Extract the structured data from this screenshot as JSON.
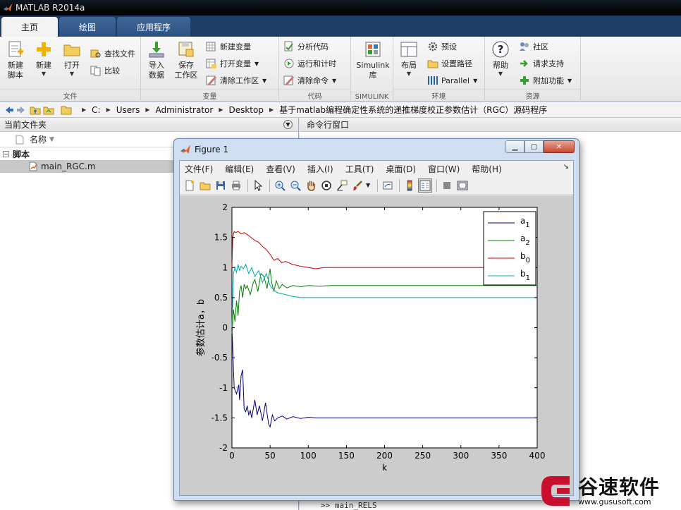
{
  "app": {
    "title": "MATLAB R2014a"
  },
  "tabs": [
    {
      "label": "主页",
      "active": true
    },
    {
      "label": "绘图",
      "active": false
    },
    {
      "label": "应用程序",
      "active": false
    }
  ],
  "ribbon": {
    "file": {
      "label": "文件",
      "new_script": "新建\n脚本",
      "new": "新建",
      "open": "打开",
      "find_files": "查找文件",
      "compare": "比较"
    },
    "variable": {
      "label": "变量",
      "import": "导入\n数据",
      "save_ws": "保存\n工作区",
      "new_var": "新建变量",
      "open_var": "打开变量",
      "clear_ws": "清除工作区"
    },
    "code": {
      "label": "代码",
      "analyze": "分析代码",
      "run_time": "运行和计时",
      "clear_cmd": "清除命令"
    },
    "simulink": {
      "label": "SIMULINK",
      "library": "Simulink\n库"
    },
    "env": {
      "label": "环境",
      "layout": "布局",
      "prefs": "预设",
      "set_path": "设置路径",
      "parallel": "Parallel"
    },
    "resources": {
      "label": "资源",
      "help": "帮助",
      "community": "社区",
      "support": "请求支持",
      "addons": "附加功能"
    }
  },
  "address": {
    "crumbs": [
      "C:",
      "Users",
      "Administrator",
      "Desktop",
      "基于matlab编程确定性系统的递推梯度校正参数估计（RGC）源码程序"
    ]
  },
  "left_panel": {
    "title": "当前文件夹",
    "col_name": "名称",
    "group": "脚本",
    "file": "main_RGC.m"
  },
  "command_window": {
    "title": "命令行窗口",
    "last_line": ">> main_RELS"
  },
  "figure": {
    "title": "Figure 1",
    "menus": [
      "文件(F)",
      "编辑(E)",
      "查看(V)",
      "插入(I)",
      "工具(T)",
      "桌面(D)",
      "窗口(W)",
      "帮助(H)"
    ]
  },
  "chart_data": {
    "type": "line",
    "xlabel": "k",
    "ylabel": "参数估计a，b",
    "xlim": [
      0,
      400
    ],
    "ylim": [
      -2,
      2
    ],
    "xticks": [
      0,
      50,
      100,
      150,
      200,
      250,
      300,
      350,
      400
    ],
    "yticks": [
      -2,
      -1.5,
      -1,
      -0.5,
      0,
      0.5,
      1,
      1.5,
      2
    ],
    "legend_position": "top-right",
    "series": [
      {
        "name": "a",
        "sub": "1",
        "color": "#000080",
        "x": [
          0,
          3,
          6,
          9,
          10,
          12,
          14,
          16,
          18,
          20,
          22,
          24,
          26,
          28,
          30,
          33,
          36,
          40,
          44,
          48,
          50,
          53,
          56,
          60,
          66,
          72,
          80,
          90,
          100,
          110,
          125,
          150,
          200,
          300,
          400
        ],
        "y": [
          0,
          -1.0,
          -1.1,
          -0.95,
          -1.2,
          -0.8,
          -0.7,
          -1.35,
          -1.4,
          -1.3,
          -1.45,
          -1.38,
          -1.5,
          -1.35,
          -1.2,
          -1.45,
          -1.3,
          -1.55,
          -1.25,
          -1.6,
          -1.65,
          -1.45,
          -1.55,
          -1.5,
          -1.47,
          -1.52,
          -1.48,
          -1.51,
          -1.49,
          -1.5,
          -1.5,
          -1.5,
          -1.5,
          -1.5,
          -1.5
        ]
      },
      {
        "name": "a",
        "sub": "2",
        "color": "#008000",
        "x": [
          0,
          2,
          4,
          6,
          8,
          10,
          12,
          14,
          16,
          18,
          20,
          24,
          28,
          30,
          34,
          38,
          42,
          46,
          50,
          52,
          55,
          58,
          62,
          66,
          72,
          80,
          90,
          100,
          115,
          130,
          160,
          200,
          300,
          400
        ],
        "y": [
          -0.1,
          0.3,
          0.1,
          0.45,
          0.2,
          0.6,
          0.7,
          0.5,
          0.72,
          0.65,
          0.7,
          0.55,
          0.75,
          0.8,
          0.6,
          0.9,
          0.85,
          0.65,
          0.98,
          0.75,
          0.6,
          0.78,
          0.65,
          0.72,
          0.66,
          0.7,
          0.68,
          0.7,
          0.69,
          0.7,
          0.7,
          0.7,
          0.7,
          0.7
        ]
      },
      {
        "name": "b",
        "sub": "0",
        "color": "#cc0000",
        "x": [
          0,
          1,
          3,
          5,
          8,
          12,
          16,
          20,
          25,
          30,
          35,
          40,
          45,
          50,
          55,
          60,
          65,
          70,
          80,
          90,
          100,
          110,
          120,
          140,
          160,
          200,
          300,
          400
        ],
        "y": [
          1.0,
          1.5,
          1.6,
          1.58,
          1.6,
          1.56,
          1.58,
          1.55,
          1.5,
          1.45,
          1.42,
          1.35,
          1.3,
          1.22,
          1.12,
          1.15,
          1.08,
          1.1,
          1.05,
          1.02,
          1.0,
          0.98,
          1.0,
          1.0,
          1.0,
          1.0,
          1.0,
          1.0
        ]
      },
      {
        "name": "b",
        "sub": "1",
        "color": "#00aaaa",
        "x": [
          0,
          2,
          4,
          6,
          8,
          10,
          12,
          15,
          18,
          22,
          26,
          30,
          35,
          40,
          45,
          50,
          55,
          60,
          70,
          80,
          90,
          100,
          120,
          150,
          200,
          300,
          400
        ],
        "y": [
          0.0,
          0.9,
          1.0,
          0.92,
          1.05,
          0.95,
          1.02,
          0.98,
          1.05,
          0.9,
          1.0,
          0.85,
          0.95,
          0.75,
          0.9,
          0.7,
          0.62,
          0.58,
          0.55,
          0.52,
          0.5,
          0.5,
          0.5,
          0.5,
          0.5,
          0.5,
          0.5
        ]
      }
    ]
  },
  "watermark": {
    "text": "谷速软件",
    "url": "www.gususoft.com",
    "color": "#c8102e"
  }
}
